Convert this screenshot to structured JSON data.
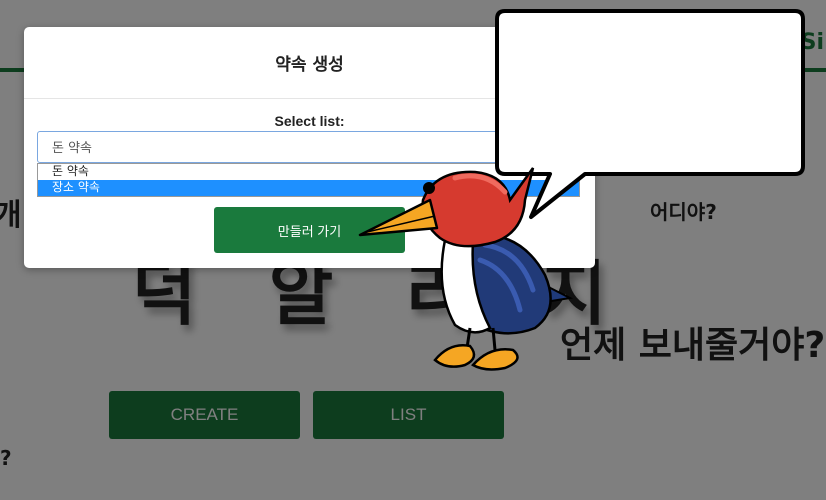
{
  "background": {
    "logo_text": "Si",
    "fragment_left": "개",
    "where_text": "어디야?",
    "big_heading": "덕 알 리 지",
    "when_text": "언제 보내줄거야?",
    "question_mark": "?",
    "create_button": "CREATE",
    "list_button": "LIST"
  },
  "modal": {
    "title": "약속 생성",
    "select_label": "Select list:",
    "select_value": "돈 약속",
    "options": [
      {
        "label": "돈 약속",
        "selected": false
      },
      {
        "label": "장소 약속",
        "selected": true
      }
    ],
    "submit_button": "만들러 가기"
  },
  "colors": {
    "brand_green": "#1a7a3d",
    "highlight_blue": "#1e90ff",
    "overlay": "rgba(0,0,0,0.5)"
  },
  "mascot": {
    "icon": "woodpecker-mascot-icon",
    "speech_bubble_text": ""
  }
}
